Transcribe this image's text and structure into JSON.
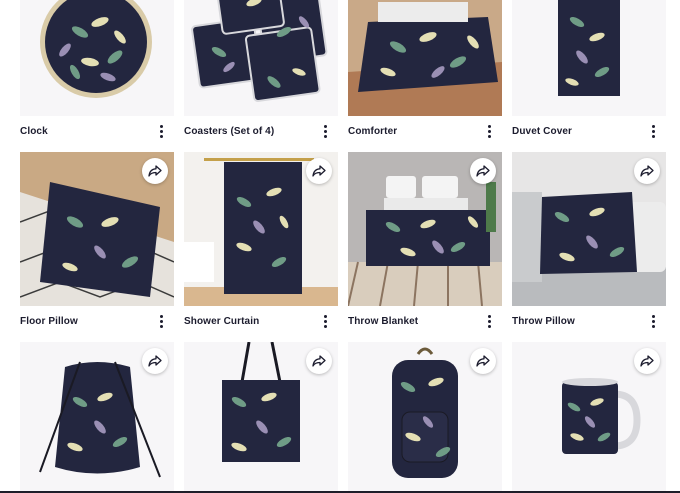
{
  "products": [
    {
      "title": "Clock",
      "share": false
    },
    {
      "title": "Coasters (Set of 4)",
      "share": false
    },
    {
      "title": "Comforter",
      "share": false
    },
    {
      "title": "Duvet Cover",
      "share": false
    },
    {
      "title": "Floor Pillow",
      "share": true
    },
    {
      "title": "Shower Curtain",
      "share": true
    },
    {
      "title": "Throw Blanket",
      "share": true
    },
    {
      "title": "Throw Pillow",
      "share": true
    },
    {
      "title": "",
      "share": true
    },
    {
      "title": "",
      "share": true
    },
    {
      "title": "",
      "share": true
    },
    {
      "title": "",
      "share": true
    }
  ],
  "icons": {
    "share": "share-arrow-icon",
    "more": "kebab-menu-icon"
  },
  "colors": {
    "pattern_base": "#23263f",
    "leaf_green": "#6f9c86",
    "leaf_cream": "#e4dfb4",
    "leaf_lilac": "#9a8fb4",
    "text": "#1c1c2e"
  }
}
